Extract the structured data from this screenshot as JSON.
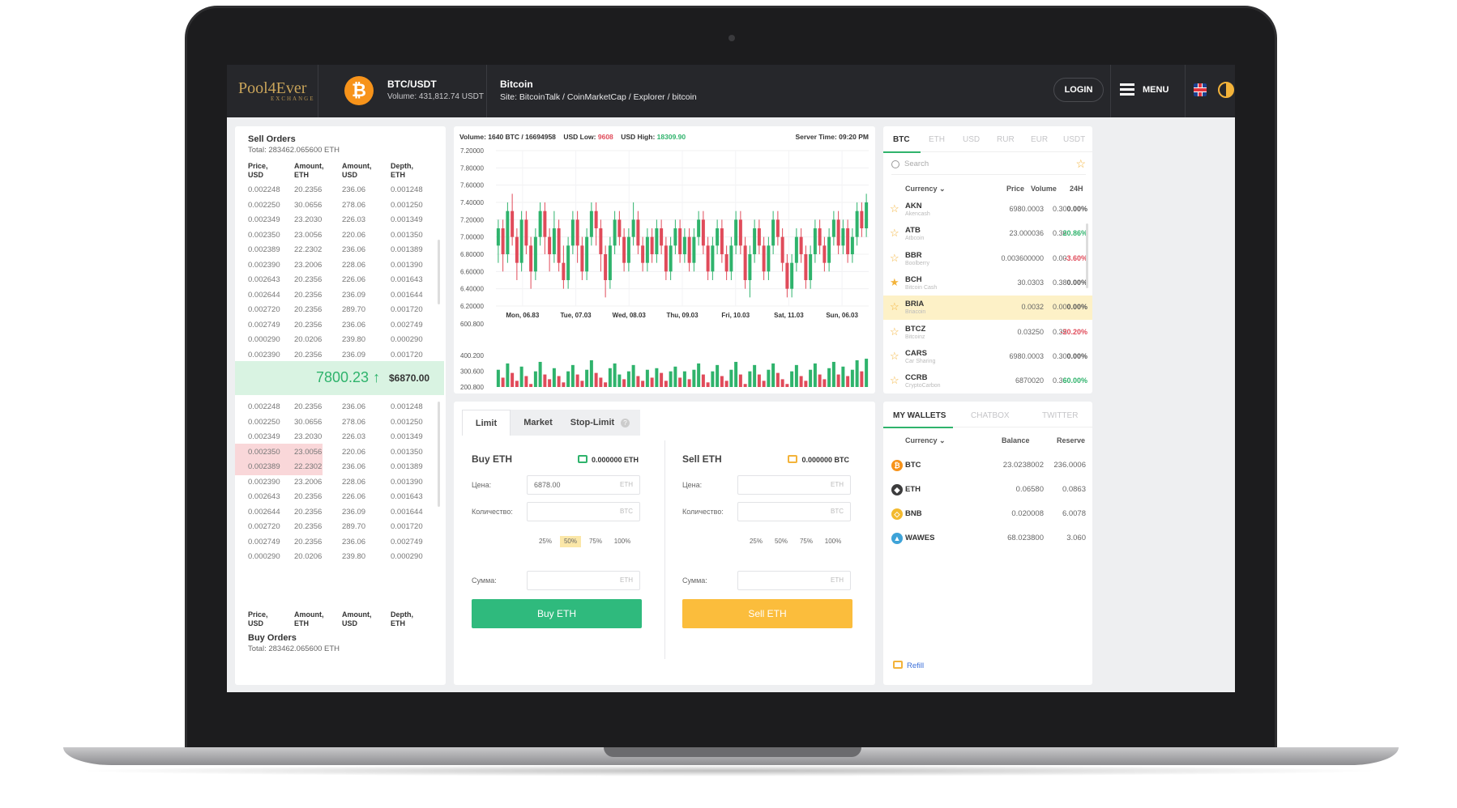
{
  "header": {
    "logo": "Pool4Ever",
    "logo_sub": "EXCHANGE",
    "coin_symbol": "₿",
    "pair": "BTC/USDT",
    "volume": "Volume: 431,812.74  USDT",
    "coin_name": "Bitcoin",
    "site": "Site: BitcoinTalk / CoinMarketCap / Explorer / bitcoin",
    "login": "LOGIN",
    "menu": "MENU",
    "flag_icon": "uk-flag-icon",
    "theme_icon": "theme-toggle-icon"
  },
  "orderbook": {
    "sell_title": "Sell Orders",
    "sell_total": "Total: 283462.065600 ETH",
    "buy_title": "Buy Orders",
    "buy_total": "Total: 283462.065600 ETH",
    "columns": [
      "Price, USD",
      "Amount, ETH",
      "Amount, USD",
      "Depth, ETH"
    ],
    "last_price": "7800.23 ↑",
    "last_usd": "$6870.00",
    "sell_rows": [
      [
        "0.002248",
        "20.2356",
        "236.06",
        "0.001248"
      ],
      [
        "0.002250",
        "30.0656",
        "278.06",
        "0.001250"
      ],
      [
        "0.002349",
        "23.2030",
        "226.03",
        "0.001349"
      ],
      [
        "0.002350",
        "23.0056",
        "220.06",
        "0.001350"
      ],
      [
        "0.002389",
        "22.2302",
        "236.06",
        "0.001389"
      ],
      [
        "0.002390",
        "23.2006",
        "228.06",
        "0.001390"
      ],
      [
        "0.002643",
        "20.2356",
        "226.06",
        "0.001643"
      ],
      [
        "0.002644",
        "20.2356",
        "236.09",
        "0.001644"
      ],
      [
        "0.002720",
        "20.2356",
        "289.70",
        "0.001720"
      ],
      [
        "0.002749",
        "20.2356",
        "236.06",
        "0.002749"
      ],
      [
        "0.000290",
        "20.0206",
        "239.80",
        "0.000290"
      ],
      [
        "0.002390",
        "20.2356",
        "236.09",
        "0.001720"
      ]
    ],
    "buy_rows": [
      [
        "0.002248",
        "20.2356",
        "236.06",
        "0.001248"
      ],
      [
        "0.002250",
        "30.0656",
        "278.06",
        "0.001250"
      ],
      [
        "0.002349",
        "23.2030",
        "226.03",
        "0.001349"
      ],
      [
        "0.002350",
        "23.0056",
        "220.06",
        "0.001350"
      ],
      [
        "0.002389",
        "22.2302",
        "236.06",
        "0.001389"
      ],
      [
        "0.002390",
        "23.2006",
        "228.06",
        "0.001390"
      ],
      [
        "0.002643",
        "20.2356",
        "226.06",
        "0.001643"
      ],
      [
        "0.002644",
        "20.2356",
        "236.09",
        "0.001644"
      ],
      [
        "0.002720",
        "20.2356",
        "289.70",
        "0.001720"
      ],
      [
        "0.002749",
        "20.2356",
        "236.06",
        "0.002749"
      ],
      [
        "0.000290",
        "20.0206",
        "239.80",
        "0.000290"
      ]
    ]
  },
  "chart": {
    "volume_label": "Volume: 1640 BTC / 16694958",
    "low_label": "USD Low:",
    "low_value": "9608",
    "high_label": "USD High:",
    "high_value": "18309.90",
    "server_time": "Server Time: 09:20 PM"
  },
  "chart_data": {
    "type": "candlestick",
    "price_ticks": [
      "7.20000",
      "7.80000",
      "7.60000",
      "7.40000",
      "7.20000",
      "7.00000",
      "6.80000",
      "6.60000",
      "6.40000",
      "6.20000"
    ],
    "price_tick_values": [
      8.0,
      7.8,
      7.6,
      7.4,
      7.2,
      7.0,
      6.8,
      6.6,
      6.4,
      6.2
    ],
    "x_labels": [
      "Mon, 06.83",
      "Tue, 07.03",
      "Wed, 08.03",
      "Thu, 09.03",
      "Fri, 10.03",
      "Sat, 11.03",
      "Sun, 06.03"
    ],
    "volume_ticks": [
      "600.800",
      "400.200",
      "300.600",
      "200.800"
    ],
    "volume_tick_values": [
      600.8,
      400.2,
      300.6,
      200.8
    ],
    "colors": {
      "up": "#2fb36c",
      "down": "#e04b5a"
    },
    "candles": [
      [
        6.9,
        7.1,
        6.7,
        7.2
      ],
      [
        7.1,
        6.8,
        6.6,
        7.2
      ],
      [
        6.8,
        7.3,
        6.7,
        7.4
      ],
      [
        7.3,
        7.0,
        6.9,
        7.5
      ],
      [
        7.0,
        6.7,
        6.5,
        7.1
      ],
      [
        6.7,
        7.2,
        6.6,
        7.3
      ],
      [
        7.2,
        6.9,
        6.8,
        7.3
      ],
      [
        6.9,
        6.6,
        6.4,
        7.0
      ],
      [
        6.6,
        7.0,
        6.5,
        7.1
      ],
      [
        7.0,
        7.3,
        6.9,
        7.4
      ],
      [
        7.3,
        7.0,
        6.8,
        7.4
      ],
      [
        7.0,
        6.8,
        6.6,
        7.1
      ],
      [
        6.8,
        7.1,
        6.7,
        7.3
      ],
      [
        7.1,
        6.7,
        6.6,
        7.2
      ],
      [
        6.7,
        6.5,
        6.4,
        6.9
      ],
      [
        6.5,
        6.9,
        6.4,
        7.0
      ],
      [
        6.9,
        7.2,
        6.8,
        7.3
      ],
      [
        7.2,
        6.9,
        6.7,
        7.3
      ],
      [
        6.9,
        6.6,
        6.5,
        7.0
      ],
      [
        6.6,
        7.0,
        6.5,
        7.1
      ],
      [
        7.0,
        7.3,
        6.9,
        7.4
      ],
      [
        7.3,
        7.1,
        6.9,
        7.4
      ],
      [
        7.1,
        6.8,
        6.6,
        7.2
      ],
      [
        6.8,
        6.5,
        6.3,
        6.9
      ],
      [
        6.5,
        6.9,
        6.4,
        7.0
      ],
      [
        6.9,
        7.2,
        6.8,
        7.3
      ],
      [
        7.2,
        7.0,
        6.9,
        7.3
      ],
      [
        7.0,
        6.7,
        6.6,
        7.1
      ],
      [
        6.7,
        7.0,
        6.6,
        7.1
      ],
      [
        7.0,
        7.2,
        6.9,
        7.4
      ],
      [
        7.2,
        6.9,
        6.8,
        7.3
      ],
      [
        6.9,
        6.7,
        6.6,
        7.0
      ],
      [
        6.7,
        7.0,
        6.6,
        7.1
      ],
      [
        7.0,
        6.8,
        6.7,
        7.1
      ],
      [
        6.8,
        7.1,
        6.7,
        7.2
      ],
      [
        7.1,
        6.9,
        6.8,
        7.2
      ],
      [
        6.9,
        6.6,
        6.5,
        7.0
      ],
      [
        6.6,
        6.9,
        6.5,
        7.0
      ],
      [
        6.9,
        7.1,
        6.8,
        7.2
      ],
      [
        7.1,
        6.8,
        6.7,
        7.2
      ],
      [
        6.8,
        7.0,
        6.7,
        7.1
      ],
      [
        7.0,
        6.7,
        6.6,
        7.1
      ],
      [
        6.7,
        7.0,
        6.6,
        7.1
      ],
      [
        7.0,
        7.2,
        6.9,
        7.3
      ],
      [
        7.2,
        6.9,
        6.8,
        7.3
      ],
      [
        6.9,
        6.6,
        6.5,
        7.0
      ],
      [
        6.6,
        6.9,
        6.5,
        7.0
      ],
      [
        6.9,
        7.1,
        6.8,
        7.2
      ],
      [
        7.1,
        6.8,
        6.7,
        7.2
      ],
      [
        6.8,
        6.6,
        6.5,
        6.9
      ],
      [
        6.6,
        6.9,
        6.5,
        7.0
      ],
      [
        6.9,
        7.2,
        6.8,
        7.3
      ],
      [
        7.2,
        6.9,
        6.8,
        7.3
      ],
      [
        6.9,
        6.5,
        6.4,
        7.0
      ],
      [
        6.5,
        6.8,
        6.3,
        6.9
      ],
      [
        6.8,
        7.1,
        6.7,
        7.2
      ],
      [
        7.1,
        6.9,
        6.8,
        7.2
      ],
      [
        6.9,
        6.6,
        6.5,
        7.0
      ],
      [
        6.6,
        6.9,
        6.5,
        7.0
      ],
      [
        6.9,
        7.2,
        6.8,
        7.3
      ],
      [
        7.2,
        7.0,
        6.9,
        7.3
      ],
      [
        7.0,
        6.7,
        6.6,
        7.1
      ],
      [
        6.7,
        6.4,
        6.3,
        6.8
      ],
      [
        6.4,
        6.7,
        6.3,
        6.8
      ],
      [
        6.7,
        7.0,
        6.6,
        7.1
      ],
      [
        7.0,
        6.8,
        6.7,
        7.1
      ],
      [
        6.8,
        6.5,
        6.4,
        6.9
      ],
      [
        6.5,
        6.8,
        6.4,
        6.9
      ],
      [
        6.8,
        7.1,
        6.7,
        7.2
      ],
      [
        7.1,
        6.9,
        6.8,
        7.2
      ],
      [
        6.9,
        6.7,
        6.6,
        7.0
      ],
      [
        6.7,
        7.0,
        6.6,
        7.1
      ],
      [
        7.0,
        7.2,
        6.9,
        7.3
      ],
      [
        7.2,
        6.9,
        6.8,
        7.3
      ],
      [
        6.9,
        7.1,
        6.8,
        7.2
      ],
      [
        7.1,
        6.8,
        6.7,
        7.2
      ],
      [
        6.8,
        7.0,
        6.7,
        7.1
      ],
      [
        7.0,
        7.3,
        6.9,
        7.4
      ],
      [
        7.3,
        7.1,
        7.0,
        7.4
      ],
      [
        7.1,
        7.4,
        7.0,
        7.5
      ]
    ],
    "volumes": [
      [
        310,
        1
      ],
      [
        260,
        0
      ],
      [
        350,
        1
      ],
      [
        290,
        0
      ],
      [
        240,
        0
      ],
      [
        330,
        1
      ],
      [
        270,
        0
      ],
      [
        220,
        0
      ],
      [
        300,
        1
      ],
      [
        360,
        1
      ],
      [
        280,
        0
      ],
      [
        250,
        0
      ],
      [
        320,
        1
      ],
      [
        270,
        0
      ],
      [
        230,
        0
      ],
      [
        300,
        1
      ],
      [
        340,
        1
      ],
      [
        280,
        0
      ],
      [
        240,
        0
      ],
      [
        310,
        1
      ],
      [
        370,
        1
      ],
      [
        290,
        0
      ],
      [
        260,
        0
      ],
      [
        230,
        0
      ],
      [
        320,
        1
      ],
      [
        350,
        1
      ],
      [
        280,
        1
      ],
      [
        250,
        0
      ],
      [
        300,
        1
      ],
      [
        340,
        1
      ],
      [
        270,
        0
      ],
      [
        240,
        0
      ],
      [
        310,
        1
      ],
      [
        260,
        0
      ],
      [
        320,
        1
      ],
      [
        290,
        0
      ],
      [
        240,
        0
      ],
      [
        300,
        1
      ],
      [
        330,
        1
      ],
      [
        260,
        0
      ],
      [
        300,
        1
      ],
      [
        250,
        0
      ],
      [
        310,
        1
      ],
      [
        350,
        1
      ],
      [
        280,
        0
      ],
      [
        230,
        0
      ],
      [
        300,
        1
      ],
      [
        340,
        1
      ],
      [
        270,
        0
      ],
      [
        240,
        0
      ],
      [
        310,
        1
      ],
      [
        360,
        1
      ],
      [
        280,
        0
      ],
      [
        220,
        0
      ],
      [
        300,
        1
      ],
      [
        340,
        1
      ],
      [
        280,
        0
      ],
      [
        240,
        0
      ],
      [
        310,
        1
      ],
      [
        350,
        1
      ],
      [
        290,
        0
      ],
      [
        250,
        0
      ],
      [
        220,
        0
      ],
      [
        300,
        1
      ],
      [
        340,
        1
      ],
      [
        270,
        0
      ],
      [
        240,
        0
      ],
      [
        310,
        1
      ],
      [
        350,
        1
      ],
      [
        280,
        0
      ],
      [
        250,
        0
      ],
      [
        320,
        1
      ],
      [
        360,
        1
      ],
      [
        280,
        0
      ],
      [
        330,
        1
      ],
      [
        270,
        0
      ],
      [
        310,
        1
      ],
      [
        370,
        1
      ],
      [
        300,
        0
      ],
      [
        380,
        1
      ]
    ]
  },
  "trade": {
    "tabs": [
      "Limit",
      "Market",
      "Stop-Limit"
    ],
    "help_icon": "?",
    "buy": {
      "title": "Buy ETH",
      "balance": "0.000000 ETH",
      "price_label": "Цена:",
      "price_value": "6878.00",
      "price_unit": "ETH",
      "qty_label": "Количество:",
      "qty_unit": "BTC",
      "sum_label": "Сумма:",
      "sum_unit": "ETH",
      "percents": [
        "25%",
        "50%",
        "75%",
        "100%"
      ],
      "button": "Buy ETH"
    },
    "sell": {
      "title": "Sell ETH",
      "balance": "0.000000 BTC",
      "price_label": "Цена:",
      "price_unit": "ЕТН",
      "qty_label": "Количество:",
      "qty_unit": "BTC",
      "sum_label": "Сумма:",
      "sum_unit": "ETH",
      "percents": [
        "25%",
        "50%",
        "75%",
        "100%"
      ],
      "button": "Sell ETH"
    },
    "colors": {
      "buy": "#2fba7d",
      "sell": "#fbbd3c"
    }
  },
  "market": {
    "tabs": [
      "BTC",
      "ETH",
      "USD",
      "RUR",
      "EUR",
      "USDT"
    ],
    "search_placeholder": "Search",
    "columns": [
      "Currency ⌄",
      "Price",
      "Volume",
      "24H"
    ],
    "rows": [
      {
        "code": "AKN",
        "name": "Akencash",
        "price": "6980.0003",
        "volume": "0.30",
        "change": "0.00%",
        "dir": "neu",
        "fav": false
      },
      {
        "code": "ATB",
        "name": "Atbcoin",
        "price": "23.000036",
        "volume": "0.36",
        "change": "20.86%",
        "dir": "pos",
        "fav": false
      },
      {
        "code": "BBR",
        "name": "Boolberry",
        "price": "0.003600000",
        "volume": "0.00",
        "change": "-3.60%",
        "dir": "neg",
        "fav": false
      },
      {
        "code": "BCH",
        "name": "Bitcoin Cash",
        "price": "30.0303",
        "volume": "0.38",
        "change": "0.00%",
        "dir": "neu",
        "fav": true
      },
      {
        "code": "BRIA",
        "name": "Briacoin",
        "price": "0.0032",
        "volume": "0.00",
        "change": "0.00%",
        "dir": "neu",
        "fav": false,
        "selected": true
      },
      {
        "code": "BTCZ",
        "name": "Bitcoinz",
        "price": "0.03250",
        "volume": "0.35",
        "change": "-20.20%",
        "dir": "neg",
        "fav": false
      },
      {
        "code": "CARS",
        "name": "Car Sharing",
        "price": "6980.0003",
        "volume": "0.30",
        "change": "0.00%",
        "dir": "neu",
        "fav": false
      },
      {
        "code": "CCRB",
        "name": "CryptoCarbon",
        "price": "6870020",
        "volume": "0.36",
        "change": "60.00%",
        "dir": "pos",
        "fav": false
      }
    ]
  },
  "wallets": {
    "tabs": [
      "MY WALLETS",
      "CHATBOX",
      "TWITTER"
    ],
    "columns": [
      "Currency ⌄",
      "Balance",
      "Reserve"
    ],
    "rows": [
      {
        "code": "BTC",
        "balance": "23.0238002",
        "reserve": "236.0006",
        "icon": "bitcoin-icon",
        "color": "#f7931a"
      },
      {
        "code": "ETH",
        "balance": "0.06580",
        "reserve": "0.0863",
        "icon": "ethereum-icon",
        "color": "#3c3c3d"
      },
      {
        "code": "BNB",
        "balance": "0.020008",
        "reserve": "6.0078",
        "icon": "binance-icon",
        "color": "#f3ba2f"
      },
      {
        "code": "WAWES",
        "balance": "68.023800",
        "reserve": "3.060",
        "icon": "waves-icon",
        "color": "#3ea3d8"
      }
    ],
    "refill": "Refill"
  }
}
